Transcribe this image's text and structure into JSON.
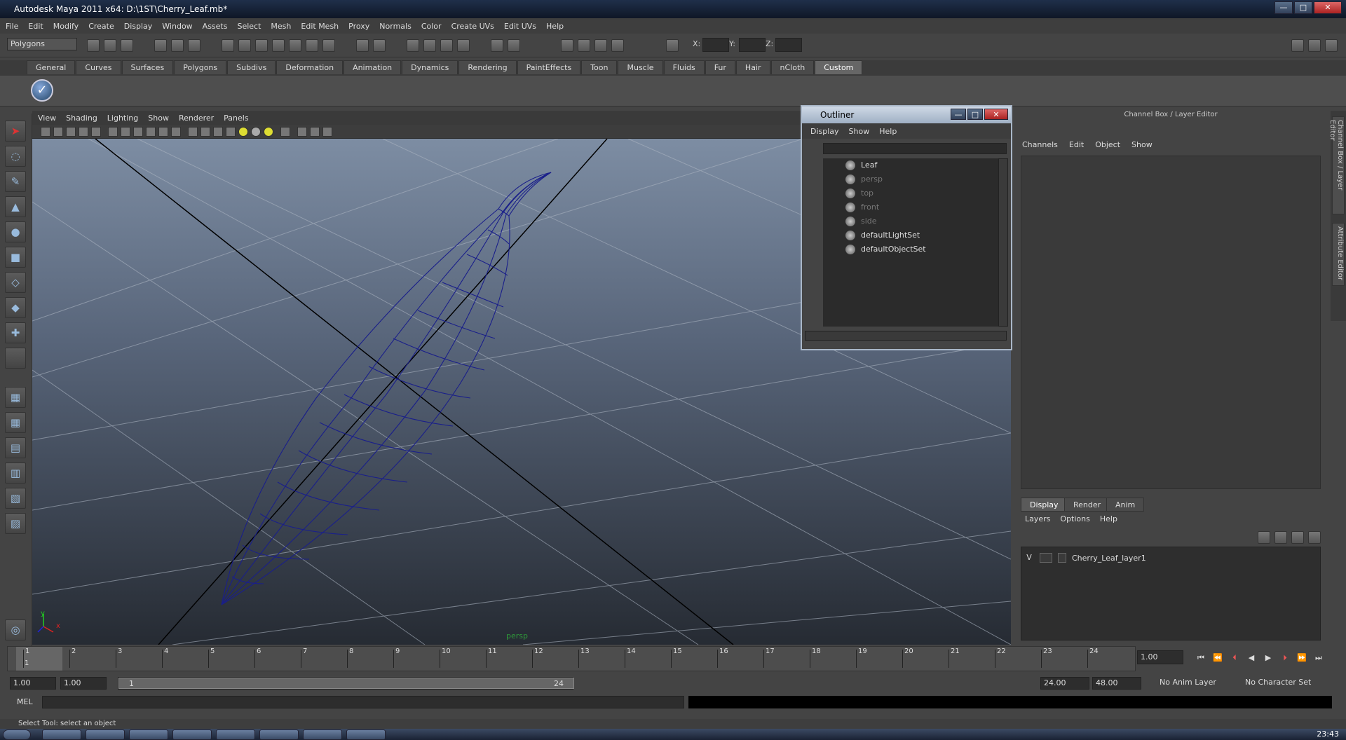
{
  "window": {
    "title": "Autodesk Maya 2011 x64: D:\\1ST\\Cherry_Leaf.mb*",
    "minimize": "—",
    "maximize": "□",
    "close": "✕"
  },
  "menubar": [
    "File",
    "Edit",
    "Modify",
    "Create",
    "Display",
    "Window",
    "Assets",
    "Select",
    "Mesh",
    "Edit Mesh",
    "Proxy",
    "Normals",
    "Color",
    "Create UVs",
    "Edit UVs",
    "Help"
  ],
  "toolbar": {
    "mode": "Polygons",
    "x_label": "X:",
    "y_label": "Y:",
    "z_label": "Z:"
  },
  "shelf_tabs": [
    "General",
    "Curves",
    "Surfaces",
    "Polygons",
    "Subdivs",
    "Deformation",
    "Animation",
    "Dynamics",
    "Rendering",
    "PaintEffects",
    "Toon",
    "Muscle",
    "Fluids",
    "Fur",
    "Hair",
    "nCloth",
    "Custom"
  ],
  "shelf_active": "Custom",
  "viewport": {
    "menu": [
      "View",
      "Shading",
      "Lighting",
      "Show",
      "Renderer",
      "Panels"
    ],
    "camera_label": "persp",
    "axis_x": "x",
    "axis_y": "y"
  },
  "outliner": {
    "title": "Outliner",
    "menu": [
      "Display",
      "Show",
      "Help"
    ],
    "items": [
      {
        "label": "Leaf",
        "dim": false
      },
      {
        "label": "persp",
        "dim": true
      },
      {
        "label": "top",
        "dim": true
      },
      {
        "label": "front",
        "dim": true
      },
      {
        "label": "side",
        "dim": true
      },
      {
        "label": "defaultLightSet",
        "dim": false
      },
      {
        "label": "defaultObjectSet",
        "dim": false
      }
    ]
  },
  "channelbox": {
    "title": "Channel Box / Layer Editor",
    "menu": [
      "Channels",
      "Edit",
      "Object",
      "Show"
    ]
  },
  "sidetabs": [
    "Channel Box / Layer Editor",
    "Attribute Editor"
  ],
  "layereditor": {
    "tabs": [
      "Display",
      "Render",
      "Anim"
    ],
    "active_tab": "Display",
    "menu": [
      "Layers",
      "Options",
      "Help"
    ],
    "layer": {
      "visible": "V",
      "name": "Cherry_Leaf_layer1"
    }
  },
  "timeline": {
    "ticks": [
      "1",
      "2",
      "3",
      "4",
      "5",
      "6",
      "7",
      "8",
      "9",
      "10",
      "11",
      "12",
      "13",
      "14",
      "15",
      "16",
      "17",
      "18",
      "19",
      "20",
      "21",
      "22",
      "23",
      "24"
    ],
    "current_frame": "1",
    "current_field": "1.00"
  },
  "range": {
    "start": "1.00",
    "start2": "1.00",
    "slider_start": "1",
    "slider_end": "24",
    "end": "24.00",
    "end2": "48.00",
    "anim_layer": "No Anim Layer",
    "char_set": "No Character Set"
  },
  "mel": {
    "label": "MEL"
  },
  "helpline": "Select Tool: select an object",
  "clock": "23:43"
}
